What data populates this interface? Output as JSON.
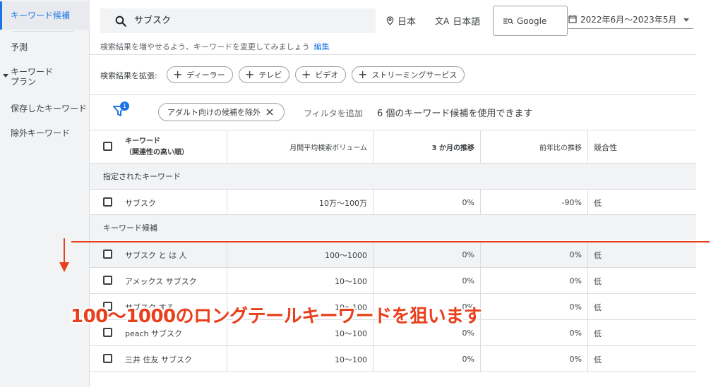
{
  "sidebar": {
    "items": [
      {
        "label": "キーワード候補"
      },
      {
        "label": "予測"
      },
      {
        "label": "キーワード\nプラン"
      },
      {
        "label": "保存したキーワード"
      },
      {
        "label": "除外キーワード"
      }
    ]
  },
  "search": {
    "value": "サブスク"
  },
  "location": {
    "label": "日本"
  },
  "language": {
    "label": "日本語"
  },
  "network": {
    "label": "Google"
  },
  "date_range": {
    "label": "2022年6月〜2023年5月"
  },
  "hint": {
    "text": "検索結果を増やせるよう、キーワードを変更してみましょう",
    "edit_link": "編集"
  },
  "expand": {
    "label": "検索結果を拡張:",
    "chips": [
      "ディーラー",
      "テレビ",
      "ビデオ",
      "ストリーミングサービス"
    ]
  },
  "filters": {
    "badge_count": "1",
    "adult_chip": "アダルト向けの候補を除外",
    "add_filter": "フィルタを追加",
    "count_text": "6 個のキーワード候補を使用できます"
  },
  "table": {
    "headers": {
      "keyword": "キーワード",
      "keyword_sub": "（関連性の高い順）",
      "volume": "月間平均検索ボリューム",
      "three_month": "3 か月の推移",
      "yoy": "前年比の推移",
      "competition": "競合性"
    },
    "section_specified": "指定されたキーワード",
    "section_ideas": "キーワード候補",
    "specified_rows": [
      {
        "keyword": "サブスク",
        "volume": "10万〜100万",
        "three_month": "0%",
        "yoy": "-90%",
        "competition": "低"
      }
    ],
    "idea_rows": [
      {
        "keyword": "サブスク と は 人",
        "volume": "100〜1000",
        "three_month": "0%",
        "yoy": "0%",
        "competition": "低"
      },
      {
        "keyword": "アメックス サブスク",
        "volume": "10〜100",
        "three_month": "0%",
        "yoy": "0%",
        "competition": "低"
      },
      {
        "keyword": "サブスク する",
        "volume": "10〜100",
        "three_month": "0%",
        "yoy": "0%",
        "competition": "低"
      },
      {
        "keyword": "peach サブスク",
        "volume": "10〜100",
        "three_month": "0%",
        "yoy": "0%",
        "competition": "低"
      },
      {
        "keyword": "三井 住友 サブスク",
        "volume": "10〜100",
        "three_month": "0%",
        "yoy": "0%",
        "competition": "低"
      }
    ]
  },
  "annotation": {
    "text": "100〜1000のロングテールキーワードを狙います",
    "color": "#e8401c"
  },
  "colors": {
    "accent": "#1a73e8",
    "annotation": "#e8401c"
  }
}
